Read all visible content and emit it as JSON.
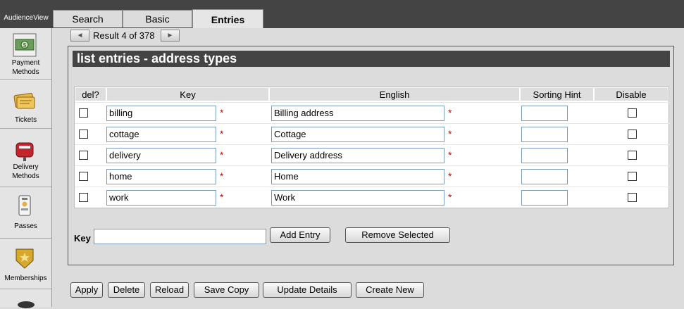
{
  "app": {
    "brand": "AudienceView"
  },
  "tabs": [
    {
      "label": "Search"
    },
    {
      "label": "Basic"
    },
    {
      "label": "Entries"
    }
  ],
  "sidebar": {
    "items": [
      {
        "label1": "Payment",
        "label2": "Methods",
        "icon": "money-icon"
      },
      {
        "label1": "Tickets",
        "label2": "",
        "icon": "ticket-icon"
      },
      {
        "label1": "Delivery",
        "label2": "Methods",
        "icon": "mailbox-icon"
      },
      {
        "label1": "Passes",
        "label2": "",
        "icon": "pass-icon"
      },
      {
        "label1": "Memberships",
        "label2": "",
        "icon": "badge-icon"
      }
    ]
  },
  "nav": {
    "prev": "◄",
    "next": "►",
    "result_text": "Result 4 of 378"
  },
  "panel": {
    "title": "list entries - address types"
  },
  "table": {
    "columns": [
      "del?",
      "Key",
      "English",
      "Sorting Hint",
      "Disable"
    ],
    "rows": [
      {
        "key": "billing",
        "english": "Billing address",
        "sorting_hint": ""
      },
      {
        "key": "cottage",
        "english": "Cottage",
        "sorting_hint": ""
      },
      {
        "key": "delivery",
        "english": "Delivery address",
        "sorting_hint": ""
      },
      {
        "key": "home",
        "english": "Home",
        "sorting_hint": ""
      },
      {
        "key": "work",
        "english": "Work",
        "sorting_hint": ""
      }
    ],
    "required_mark": "*"
  },
  "add_entry": {
    "label": "Key",
    "value": "",
    "add_button": "Add Entry",
    "remove_button": "Remove Selected"
  },
  "actions": {
    "apply": "Apply",
    "delete": "Delete",
    "reload": "Reload",
    "save_copy": "Save Copy",
    "update_details": "Update Details",
    "create_new": "Create New"
  },
  "colors": {
    "header_bar": "#444444",
    "required": "#dd0000",
    "input_border": "#7a9cb8"
  }
}
